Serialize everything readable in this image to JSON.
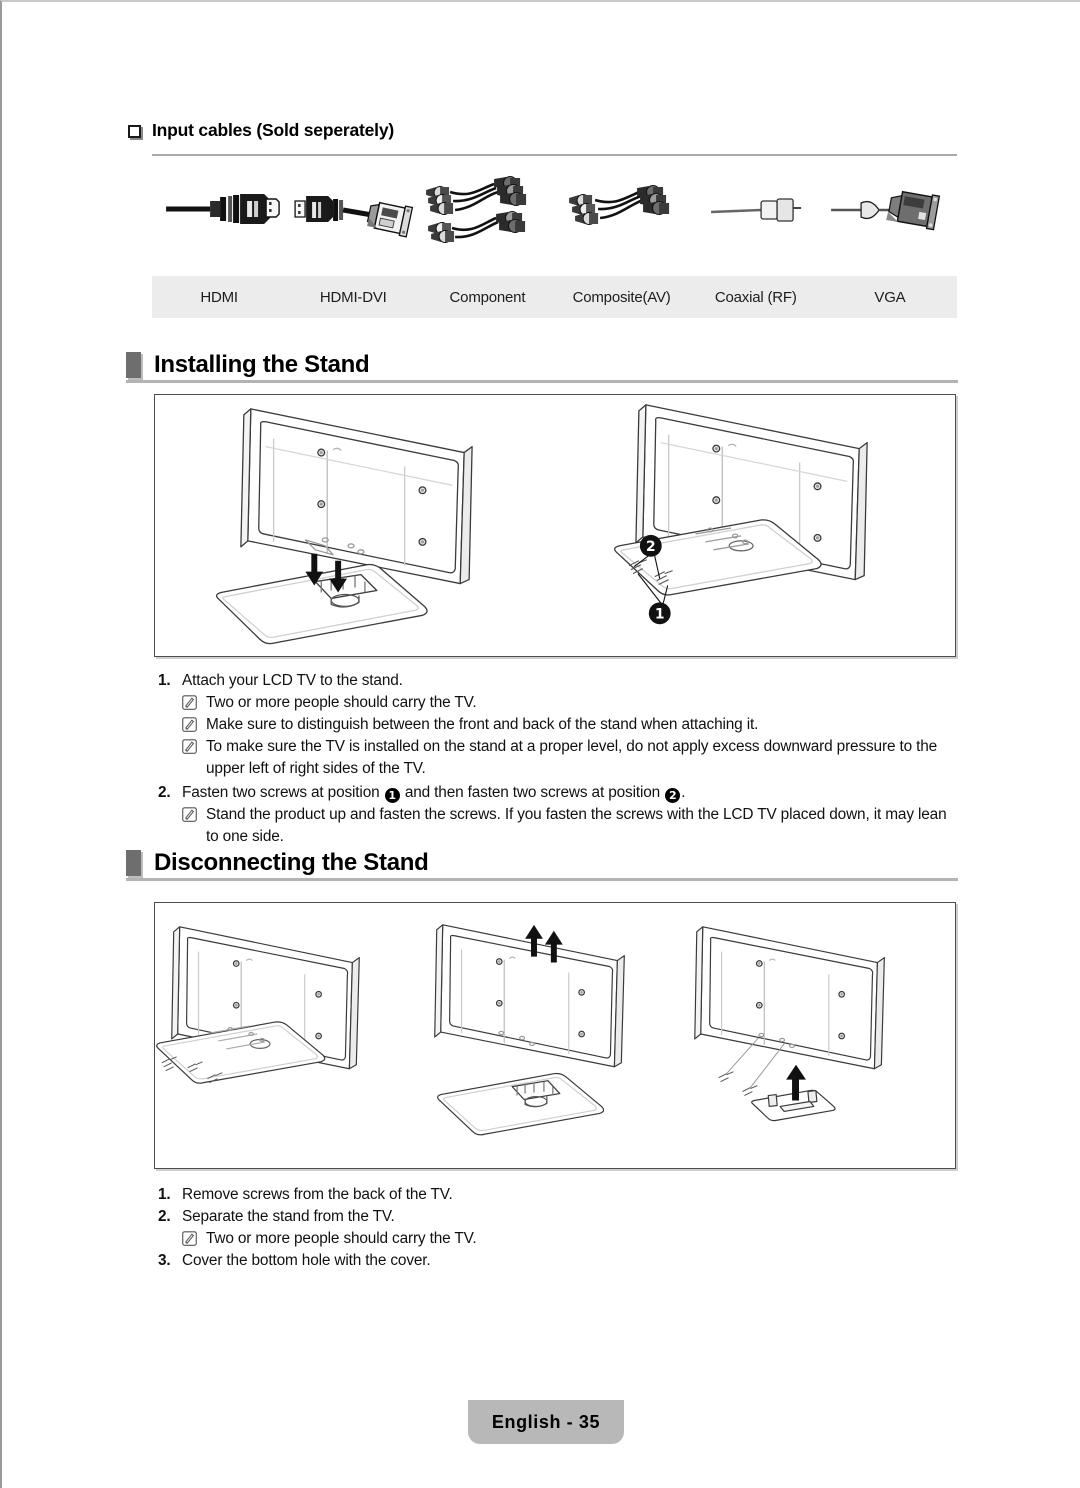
{
  "document": {
    "page_label": "English - 35"
  },
  "input_cables": {
    "heading": "Input cables (Sold seperately)",
    "items": [
      {
        "label": "HDMI",
        "icon": "hdmi-cable-icon"
      },
      {
        "label": "HDMI-DVI",
        "icon": "hdmi-dvi-cable-icon"
      },
      {
        "label": "Component",
        "icon": "component-cable-icon"
      },
      {
        "label": "Composite(AV)",
        "icon": "composite-av-cable-icon"
      },
      {
        "label": "Coaxial (RF)",
        "icon": "coaxial-rf-cable-icon"
      },
      {
        "label": "VGA",
        "icon": "vga-cable-icon"
      }
    ]
  },
  "installing": {
    "heading": "Installing the Stand",
    "figure_captions": [
      "tv-back-with-stand-base-arrows-down",
      "tv-back-with-screw-positions-1-and-2"
    ],
    "callouts": [
      "1",
      "2"
    ],
    "steps": [
      {
        "number": "1.",
        "text": "Attach your LCD TV to the stand.",
        "notes": [
          "Two or more people should carry the TV.",
          "Make sure to distinguish between the front and back of the stand when attaching it.",
          "To make sure the TV is installed on the stand at a proper level, do not apply excess downward pressure to the upper left of right sides of the TV."
        ]
      },
      {
        "number": "2.",
        "text_before": "Fasten two screws at position",
        "marker_1": "1",
        "text_middle": "and then fasten two screws at position",
        "marker_2": "2",
        "text_after": ".",
        "notes": [
          "Stand the product up and fasten the screws. If you fasten the screws with the LCD TV placed down, it may lean to one side."
        ]
      }
    ]
  },
  "disconnecting": {
    "heading": "Disconnecting the Stand",
    "figure_captions": [
      "tv-with-stand-screws-being-removed",
      "tv-lifted-off-stand-base-arrows-up",
      "tv-with-bottom-hole-cover-arrow-up"
    ],
    "steps": [
      {
        "number": "1.",
        "text": "Remove screws from the back of the TV.",
        "notes": []
      },
      {
        "number": "2.",
        "text": "Separate the stand from the TV.",
        "notes": [
          "Two or more people should carry the TV."
        ]
      },
      {
        "number": "3.",
        "text": "Cover the bottom hole with the cover.",
        "notes": []
      }
    ]
  },
  "colors": {
    "rule": "#a9a9a9",
    "heading_bar": "#6e6e6e",
    "label_strip": "#ececec",
    "footer_bg": "#b8b8b8"
  }
}
